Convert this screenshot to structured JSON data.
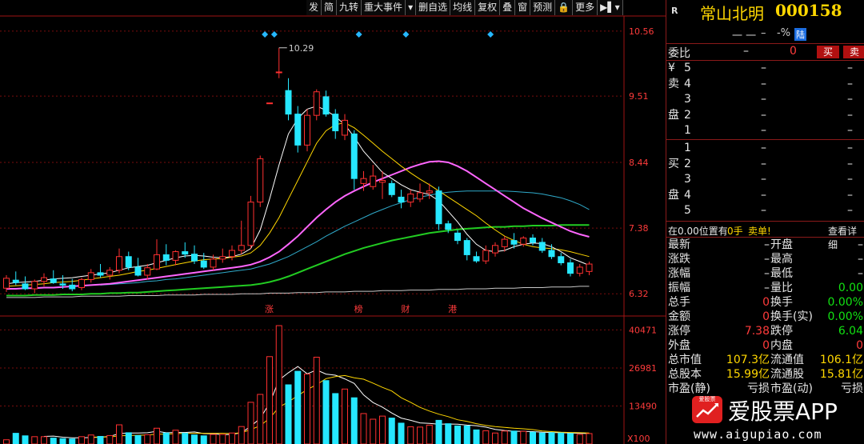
{
  "toolbar": {
    "buttons": [
      "发",
      "简",
      "九转",
      "重大事件",
      "▾",
      "删自选",
      "均线",
      "复权",
      "叠",
      "窗",
      "预测",
      "🔒",
      "更多",
      "▶▌▾"
    ]
  },
  "stock": {
    "badge": "R",
    "name": "常山北明",
    "code": "000158",
    "price_placeholder": "一 一",
    "change_placeholder": "–",
    "pct": "-%",
    "market_tag": "陆"
  },
  "book": {
    "committee_label": "委比",
    "committee_value": "–",
    "committee_diff": "0",
    "buy_btn": "买",
    "sell_btn": "卖",
    "sell_levels": [
      {
        "label": "5",
        "price": "–",
        "vol": "–"
      },
      {
        "label": "4",
        "price": "–",
        "vol": "–"
      },
      {
        "label": "3",
        "price": "–",
        "vol": "–"
      },
      {
        "label": "2",
        "price": "–",
        "vol": "–"
      },
      {
        "label": "1",
        "price": "–",
        "vol": "–"
      }
    ],
    "buy_levels": [
      {
        "label": "1",
        "price": "–",
        "vol": "–"
      },
      {
        "label": "2",
        "price": "–",
        "vol": "–"
      },
      {
        "label": "3",
        "price": "–",
        "vol": "–"
      },
      {
        "label": "4",
        "price": "–",
        "vol": "–"
      },
      {
        "label": "5",
        "price": "–",
        "vol": "–"
      }
    ],
    "sell_side_chars": [
      "¥",
      "卖",
      "盘"
    ],
    "buy_side_chars": [
      "买",
      "盘"
    ],
    "position_text": "在0.00位置有",
    "position_hands": "0手",
    "position_order": "卖单!",
    "detail_link": "查看详细"
  },
  "stats": [
    {
      "l1": "最新",
      "v1": "–",
      "l2": "开盘",
      "v2": "–"
    },
    {
      "l1": "涨跌",
      "v1": "–",
      "l2": "最高",
      "v2": "–"
    },
    {
      "l1": "涨幅",
      "v1": "–",
      "l2": "最低",
      "v2": "–"
    },
    {
      "l1": "振幅",
      "v1": "–",
      "l2": "量比",
      "v2": "0.00"
    },
    {
      "l1": "总手",
      "v1": "0",
      "l2": "换手",
      "v2": "0.00%"
    },
    {
      "l1": "金额",
      "v1": "0",
      "l2": "换手(实)",
      "v2": "0.00%"
    },
    {
      "l1": "涨停",
      "v1": "7.38",
      "l2": "跌停",
      "v2": "6.04"
    },
    {
      "l1": "外盘",
      "v1": "0",
      "l2": "内盘",
      "v2": "0"
    },
    {
      "l1": "总市值",
      "v1": "107.3亿",
      "l2": "流通值",
      "v2": "106.1亿"
    },
    {
      "l1": "总股本",
      "v1": "15.99亿",
      "l2": "流通股",
      "v2": "15.81亿"
    },
    {
      "l1": "市盈(静)",
      "v1": "亏损",
      "l2": "市盈(动)",
      "v2": "亏损"
    }
  ],
  "watermark": {
    "brand": "爱股票APP",
    "url": "www.aigupiao.com",
    "logo_text": "爱股票"
  },
  "colors": {
    "up": "#ff3030",
    "down": "#26e7ff",
    "ma5": "#ffffff",
    "ma10": "#ffd700",
    "ma20": "#ff66ff",
    "ma30": "#2fa9c9",
    "ma60": "#22cc22",
    "ma120": "#c8c8c8"
  },
  "chart_data": [
    {
      "type": "candlestick",
      "y_ticks": [
        "10.56",
        "9.51",
        "8.44",
        "7.38",
        "6.32"
      ],
      "ylim": [
        6.0,
        10.7
      ],
      "max_label": "10.29",
      "event_labels": [
        "涨",
        "榜",
        "财",
        "港"
      ],
      "candles": [
        {
          "o": 6.41,
          "h": 6.62,
          "l": 6.35,
          "c": 6.57
        },
        {
          "o": 6.54,
          "h": 6.68,
          "l": 6.46,
          "c": 6.5
        },
        {
          "o": 6.48,
          "h": 6.6,
          "l": 6.38,
          "c": 6.4
        },
        {
          "o": 6.4,
          "h": 6.55,
          "l": 6.33,
          "c": 6.52
        },
        {
          "o": 6.52,
          "h": 6.65,
          "l": 6.44,
          "c": 6.58
        },
        {
          "o": 6.56,
          "h": 6.7,
          "l": 6.48,
          "c": 6.5
        },
        {
          "o": 6.48,
          "h": 6.62,
          "l": 6.4,
          "c": 6.46
        },
        {
          "o": 6.46,
          "h": 6.56,
          "l": 6.36,
          "c": 6.4
        },
        {
          "o": 6.42,
          "h": 6.58,
          "l": 6.38,
          "c": 6.55
        },
        {
          "o": 6.55,
          "h": 6.72,
          "l": 6.5,
          "c": 6.66
        },
        {
          "o": 6.66,
          "h": 6.8,
          "l": 6.58,
          "c": 6.62
        },
        {
          "o": 6.62,
          "h": 6.75,
          "l": 6.55,
          "c": 6.7
        },
        {
          "o": 6.7,
          "h": 7.05,
          "l": 6.65,
          "c": 6.92
        },
        {
          "o": 6.92,
          "h": 7.0,
          "l": 6.7,
          "c": 6.75
        },
        {
          "o": 6.75,
          "h": 6.9,
          "l": 6.6,
          "c": 6.62
        },
        {
          "o": 6.62,
          "h": 6.8,
          "l": 6.55,
          "c": 6.74
        },
        {
          "o": 6.72,
          "h": 7.2,
          "l": 6.7,
          "c": 6.95
        },
        {
          "o": 6.95,
          "h": 7.12,
          "l": 6.78,
          "c": 6.86
        },
        {
          "o": 6.86,
          "h": 7.02,
          "l": 6.78,
          "c": 7.0
        },
        {
          "o": 7.0,
          "h": 7.15,
          "l": 6.9,
          "c": 6.96
        },
        {
          "o": 6.96,
          "h": 7.1,
          "l": 6.8,
          "c": 6.85
        },
        {
          "o": 6.85,
          "h": 6.98,
          "l": 6.72,
          "c": 6.75
        },
        {
          "o": 6.75,
          "h": 6.95,
          "l": 6.7,
          "c": 6.88
        },
        {
          "o": 6.88,
          "h": 7.05,
          "l": 6.82,
          "c": 6.92
        },
        {
          "o": 6.92,
          "h": 7.1,
          "l": 6.86,
          "c": 7.02
        },
        {
          "o": 7.02,
          "h": 7.5,
          "l": 6.96,
          "c": 7.1
        },
        {
          "o": 7.1,
          "h": 7.9,
          "l": 7.05,
          "c": 7.8
        },
        {
          "o": 7.8,
          "h": 8.55,
          "l": 7.72,
          "c": 8.5
        },
        {
          "o": 9.4,
          "h": 9.4,
          "l": 9.4,
          "c": 9.4
        },
        {
          "o": 9.9,
          "h": 10.29,
          "l": 9.8,
          "c": 9.9
        },
        {
          "o": 9.6,
          "h": 9.8,
          "l": 9.12,
          "c": 9.22
        },
        {
          "o": 9.22,
          "h": 9.35,
          "l": 8.6,
          "c": 8.72
        },
        {
          "o": 8.72,
          "h": 9.3,
          "l": 8.62,
          "c": 9.2
        },
        {
          "o": 9.2,
          "h": 9.62,
          "l": 9.12,
          "c": 9.58
        },
        {
          "o": 9.5,
          "h": 9.6,
          "l": 9.18,
          "c": 9.22
        },
        {
          "o": 9.22,
          "h": 9.3,
          "l": 8.82,
          "c": 8.95
        },
        {
          "o": 8.88,
          "h": 9.22,
          "l": 8.8,
          "c": 9.12
        },
        {
          "o": 8.9,
          "h": 8.96,
          "l": 8.0,
          "c": 8.18
        },
        {
          "o": 8.1,
          "h": 8.3,
          "l": 7.98,
          "c": 8.18
        },
        {
          "o": 8.05,
          "h": 8.4,
          "l": 8.0,
          "c": 8.22
        },
        {
          "o": 8.12,
          "h": 8.3,
          "l": 7.85,
          "c": 8.15
        },
        {
          "o": 8.1,
          "h": 8.15,
          "l": 7.88,
          "c": 7.92
        },
        {
          "o": 7.88,
          "h": 8.0,
          "l": 7.7,
          "c": 7.8
        },
        {
          "o": 7.8,
          "h": 8.0,
          "l": 7.72,
          "c": 7.93
        },
        {
          "o": 7.85,
          "h": 8.1,
          "l": 7.8,
          "c": 7.95
        },
        {
          "o": 7.95,
          "h": 8.1,
          "l": 7.85,
          "c": 7.98
        },
        {
          "o": 7.98,
          "h": 8.05,
          "l": 7.35,
          "c": 7.45
        },
        {
          "o": 7.45,
          "h": 7.5,
          "l": 7.3,
          "c": 7.36
        },
        {
          "o": 7.3,
          "h": 7.35,
          "l": 7.12,
          "c": 7.18
        },
        {
          "o": 7.18,
          "h": 7.22,
          "l": 6.86,
          "c": 6.95
        },
        {
          "o": 6.92,
          "h": 7.0,
          "l": 6.82,
          "c": 6.85
        },
        {
          "o": 6.85,
          "h": 7.1,
          "l": 6.8,
          "c": 7.02
        },
        {
          "o": 6.98,
          "h": 7.15,
          "l": 6.92,
          "c": 7.1
        },
        {
          "o": 7.08,
          "h": 7.25,
          "l": 7.0,
          "c": 7.2
        },
        {
          "o": 7.18,
          "h": 7.3,
          "l": 7.05,
          "c": 7.12
        },
        {
          "o": 7.12,
          "h": 7.25,
          "l": 7.08,
          "c": 7.22
        },
        {
          "o": 7.22,
          "h": 7.28,
          "l": 7.1,
          "c": 7.15
        },
        {
          "o": 7.15,
          "h": 7.22,
          "l": 6.98,
          "c": 7.02
        },
        {
          "o": 7.02,
          "h": 7.12,
          "l": 6.88,
          "c": 6.92
        },
        {
          "o": 6.92,
          "h": 6.98,
          "l": 6.78,
          "c": 6.82
        },
        {
          "o": 6.82,
          "h": 6.88,
          "l": 6.6,
          "c": 6.65
        },
        {
          "o": 6.65,
          "h": 6.8,
          "l": 6.6,
          "c": 6.75
        },
        {
          "o": 6.68,
          "h": 6.84,
          "l": 6.62,
          "c": 6.8
        }
      ],
      "ma5": [
        6.48,
        6.5,
        6.51,
        6.52,
        6.54,
        6.56,
        6.57,
        6.58,
        6.6,
        6.62,
        6.64,
        6.66,
        6.7,
        6.74,
        6.76,
        6.78,
        6.82,
        6.86,
        6.9,
        6.93,
        6.94,
        6.93,
        6.91,
        6.9,
        6.92,
        6.96,
        7.05,
        7.35,
        7.85,
        8.4,
        8.9,
        9.15,
        9.3,
        9.35,
        9.28,
        9.18,
        9.05,
        8.85,
        8.62,
        8.45,
        8.28,
        8.18,
        8.08,
        8.0,
        7.96,
        7.92,
        7.82,
        7.65,
        7.48,
        7.28,
        7.12,
        7.02,
        7.0,
        7.02,
        7.08,
        7.12,
        7.14,
        7.13,
        7.08,
        7.0,
        6.9,
        6.84,
        6.78
      ],
      "ma10": [
        6.44,
        6.45,
        6.46,
        6.47,
        6.48,
        6.5,
        6.51,
        6.52,
        6.54,
        6.56,
        6.58,
        6.6,
        6.62,
        6.65,
        6.68,
        6.7,
        6.73,
        6.76,
        6.79,
        6.82,
        6.85,
        6.87,
        6.88,
        6.89,
        6.91,
        6.93,
        6.98,
        7.1,
        7.3,
        7.55,
        7.85,
        8.15,
        8.45,
        8.75,
        8.95,
        9.05,
        9.08,
        9.0,
        8.88,
        8.75,
        8.62,
        8.5,
        8.38,
        8.27,
        8.17,
        8.08,
        7.98,
        7.88,
        7.78,
        7.68,
        7.58,
        7.46,
        7.35,
        7.25,
        7.18,
        7.12,
        7.08,
        7.06,
        7.05,
        7.03,
        7.0,
        6.96,
        6.92
      ],
      "ma20": [
        6.4,
        6.4,
        6.41,
        6.41,
        6.42,
        6.42,
        6.43,
        6.44,
        6.45,
        6.46,
        6.47,
        6.48,
        6.5,
        6.52,
        6.54,
        6.56,
        6.58,
        6.6,
        6.62,
        6.64,
        6.66,
        6.68,
        6.7,
        6.72,
        6.74,
        6.76,
        6.79,
        6.84,
        6.91,
        7.0,
        7.12,
        7.25,
        7.4,
        7.55,
        7.68,
        7.8,
        7.9,
        7.98,
        8.05,
        8.12,
        8.18,
        8.24,
        8.3,
        8.36,
        8.41,
        8.45,
        8.46,
        8.44,
        8.38,
        8.3,
        8.2,
        8.1,
        8.0,
        7.9,
        7.8,
        7.7,
        7.62,
        7.54,
        7.47,
        7.4,
        7.33,
        7.28,
        7.24
      ],
      "ma30": [
        null,
        null,
        null,
        null,
        null,
        null,
        null,
        null,
        null,
        null,
        6.46,
        6.47,
        6.48,
        6.49,
        6.5,
        6.52,
        6.53,
        6.55,
        6.56,
        6.58,
        6.6,
        6.62,
        6.64,
        6.66,
        6.68,
        6.7,
        6.72,
        6.76,
        6.8,
        6.86,
        6.92,
        7.0,
        7.08,
        7.16,
        7.25,
        7.33,
        7.41,
        7.48,
        7.55,
        7.62,
        7.68,
        7.74,
        7.79,
        7.84,
        7.88,
        7.91,
        7.94,
        7.96,
        7.97,
        7.98,
        7.98,
        7.98,
        7.98,
        7.98,
        7.97,
        7.96,
        7.95,
        7.93,
        7.9,
        7.87,
        7.82,
        7.76,
        7.68
      ],
      "ma60": [
        6.29,
        6.29,
        6.29,
        6.3,
        6.3,
        6.3,
        6.31,
        6.31,
        6.31,
        6.32,
        6.32,
        6.33,
        6.33,
        6.34,
        6.34,
        6.35,
        6.36,
        6.37,
        6.38,
        6.39,
        6.4,
        6.41,
        6.42,
        6.43,
        6.44,
        6.45,
        6.46,
        6.48,
        6.51,
        6.55,
        6.6,
        6.66,
        6.72,
        6.78,
        6.84,
        6.9,
        6.96,
        7.01,
        7.06,
        7.1,
        7.14,
        7.18,
        7.21,
        7.24,
        7.27,
        7.3,
        7.32,
        7.34,
        7.36,
        7.37,
        7.38,
        7.39,
        7.4,
        7.4,
        7.41,
        7.41,
        7.42,
        7.42,
        7.42,
        7.43,
        7.43,
        7.43,
        7.43
      ],
      "ma120": [
        6.26,
        6.26,
        6.26,
        6.26,
        6.27,
        6.27,
        6.27,
        6.27,
        6.28,
        6.28,
        6.28,
        6.28,
        6.28,
        6.29,
        6.29,
        6.29,
        6.29,
        6.3,
        6.3,
        6.3,
        6.3,
        6.31,
        6.31,
        6.31,
        6.31,
        6.32,
        6.32,
        6.32,
        6.33,
        6.33,
        6.33,
        6.34,
        6.34,
        6.34,
        6.35,
        6.35,
        6.35,
        6.36,
        6.36,
        6.36,
        6.37,
        6.37,
        6.37,
        6.38,
        6.38,
        6.38,
        6.39,
        6.39,
        6.39,
        6.4,
        6.4,
        6.4,
        6.41,
        6.41,
        6.41,
        6.42,
        6.42,
        6.42,
        6.43,
        6.43,
        6.43,
        6.44,
        6.44
      ]
    },
    {
      "type": "bar",
      "y_ticks": [
        "40471",
        "26981",
        "13490"
      ],
      "unit_label": "X100",
      "ylim": [
        0,
        44000
      ],
      "volumes": [
        1500,
        3800,
        2900,
        2600,
        2600,
        2100,
        1900,
        1800,
        2600,
        3200,
        2700,
        3000,
        6800,
        4000,
        3000,
        3300,
        5600,
        3900,
        4900,
        3800,
        3200,
        2900,
        3400,
        3400,
        3900,
        6200,
        14800,
        17600,
        31000,
        42000,
        21000,
        25800,
        24800,
        30800,
        22500,
        17900,
        19500,
        16400,
        10800,
        8800,
        9900,
        9200,
        7400,
        6100,
        6000,
        6700,
        8400,
        7200,
        6400,
        6400,
        5000,
        4700,
        3900,
        4600,
        4600,
        4500,
        4200,
        3900,
        4000,
        3900,
        3700,
        3400,
        3700
      ],
      "vol_ma5": [
        null,
        null,
        null,
        null,
        2700,
        2800,
        2400,
        2200,
        2200,
        2300,
        2400,
        2700,
        3700,
        3900,
        3900,
        4000,
        4500,
        4000,
        4100,
        4100,
        4300,
        3700,
        3600,
        3300,
        3400,
        4000,
        6300,
        9100,
        14500,
        22700,
        25300,
        27500,
        24900,
        26300,
        24800,
        24400,
        23100,
        21500,
        17400,
        14700,
        13100,
        11000,
        9200,
        8400,
        7500,
        7300,
        7000,
        7100,
        7000,
        6700,
        6500,
        6000,
        5200,
        4800,
        4500,
        4500,
        4400,
        4200,
        4100,
        4000,
        3900,
        3800,
        3700
      ],
      "vol_ma10": [
        null,
        null,
        null,
        null,
        null,
        null,
        null,
        null,
        null,
        2400,
        2500,
        2500,
        2900,
        3000,
        3100,
        3200,
        3500,
        3500,
        3700,
        3800,
        3800,
        3800,
        3800,
        3800,
        3700,
        4000,
        5100,
        6500,
        9100,
        13100,
        14900,
        17200,
        19300,
        21100,
        23200,
        23900,
        24300,
        23500,
        23000,
        21600,
        20100,
        18800,
        16400,
        14800,
        13000,
        11700,
        10600,
        9700,
        8600,
        8000,
        7200,
        6600,
        6200,
        5900,
        5600,
        5400,
        5100,
        4600,
        4400,
        4200,
        4100,
        4000,
        3900
      ]
    }
  ]
}
